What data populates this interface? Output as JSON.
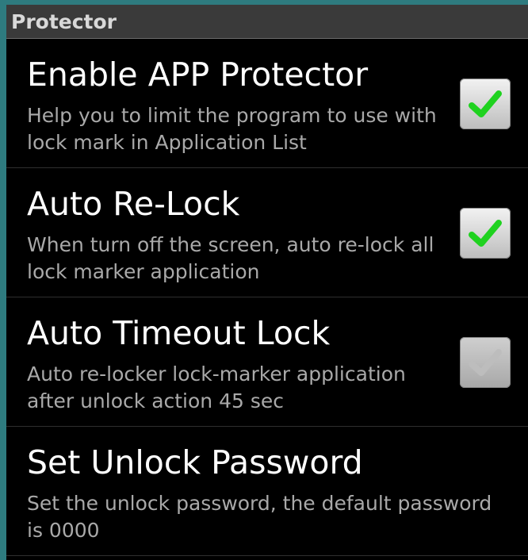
{
  "header": {
    "title": "Protector"
  },
  "settings": [
    {
      "title": "Enable APP Protector",
      "summary": "Help you to limit the program to use with lock mark in Application List",
      "checked": true,
      "enabled": true
    },
    {
      "title": "Auto Re-Lock",
      "summary": "When turn off the screen, auto re-lock all lock marker application",
      "checked": true,
      "enabled": true
    },
    {
      "title": "Auto Timeout Lock",
      "summary": "Auto re-locker lock-marker application after unlock action 45 sec",
      "checked": true,
      "enabled": false
    },
    {
      "title": "Set Unlock Password",
      "summary": "Set the unlock password, the default password is 0000"
    }
  ],
  "colors": {
    "check_green": "#1fd21f",
    "check_disabled": "#bdbdbd",
    "background": "#000000",
    "header_bg": "#3a3a3a"
  }
}
